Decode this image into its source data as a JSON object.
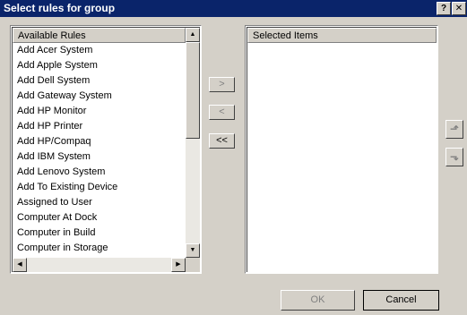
{
  "window": {
    "title": "Select rules for group",
    "help_label": "?",
    "close_label": "✕"
  },
  "available": {
    "header": "Available Rules",
    "items": [
      "Add Acer System",
      "Add Apple System",
      "Add Dell System",
      "Add Gateway System",
      "Add HP Monitor",
      "Add HP Printer",
      "Add HP/Compaq",
      "Add IBM System",
      "Add Lenovo System",
      "Add To Existing Device",
      "Assigned to User",
      "Computer At Dock",
      "Computer in Build",
      "Computer in Storage"
    ]
  },
  "selected": {
    "header": "Selected Items",
    "items": []
  },
  "transfer": {
    "add_label": ">",
    "remove_label": "<",
    "remove_all_label": "<<"
  },
  "order": {
    "up_icon": "move-up-icon",
    "down_icon": "move-down-icon"
  },
  "footer": {
    "ok_label": "OK",
    "cancel_label": "Cancel"
  },
  "colors": {
    "title_bar": "#0a246a",
    "dialog_bg": "#d4d0c8",
    "disabled_text": "#808080"
  }
}
